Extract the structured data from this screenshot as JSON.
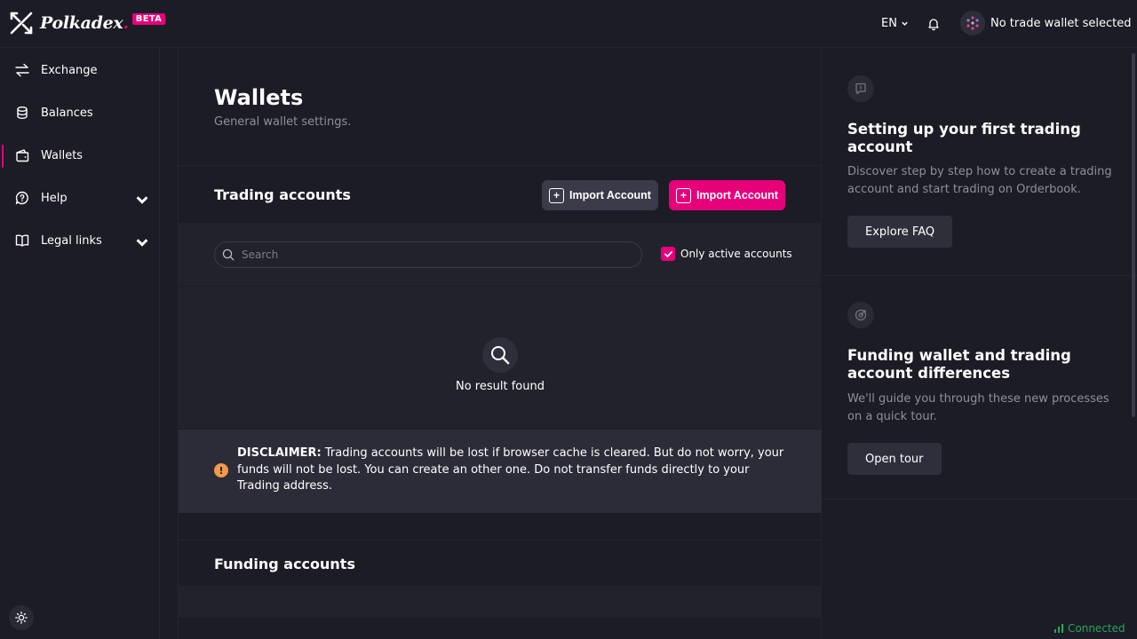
{
  "brand": {
    "name": "Polkadex",
    "badge": "BETA",
    "accent": "#e6007a"
  },
  "topbar": {
    "language": "EN",
    "wallet_status": "No trade wallet selected"
  },
  "sidebar": {
    "items": [
      {
        "label": "Exchange",
        "icon": "swap-arrows-icon"
      },
      {
        "label": "Balances",
        "icon": "coins-icon"
      },
      {
        "label": "Wallets",
        "icon": "wallet-icon",
        "active": true
      },
      {
        "label": "Help",
        "icon": "help-bubble-icon"
      },
      {
        "label": "Legal links",
        "icon": "book-icon"
      }
    ]
  },
  "main": {
    "title": "Wallets",
    "subtitle": "General wallet settings.",
    "trading": {
      "title": "Trading accounts",
      "import_dark_label": "Import Account",
      "import_pink_label": "Import Account",
      "search_placeholder": "Search",
      "only_active_label": "Only active accounts",
      "only_active_checked": true,
      "empty_text": "No result found",
      "disclaimer_bold": "DISCLAIMER:",
      "disclaimer_text": " Trading accounts will be lost if browser cache is cleared. But do not worry, your funds will not be lost. You can create an other one. Do not transfer funds directly to your Trading address."
    },
    "funding": {
      "title": "Funding accounts"
    }
  },
  "right": {
    "cards": [
      {
        "title": "Setting up your first trading account",
        "desc": "Discover step by step how to create a trading account and start trading on Orderbook.",
        "button": "Explore FAQ"
      },
      {
        "title": "Funding wallet and trading account differences",
        "desc": "We'll guide you through these new processes on a quick tour.",
        "button": "Open tour"
      }
    ]
  },
  "status": {
    "connection": "Connected",
    "color": "#26a65b"
  }
}
